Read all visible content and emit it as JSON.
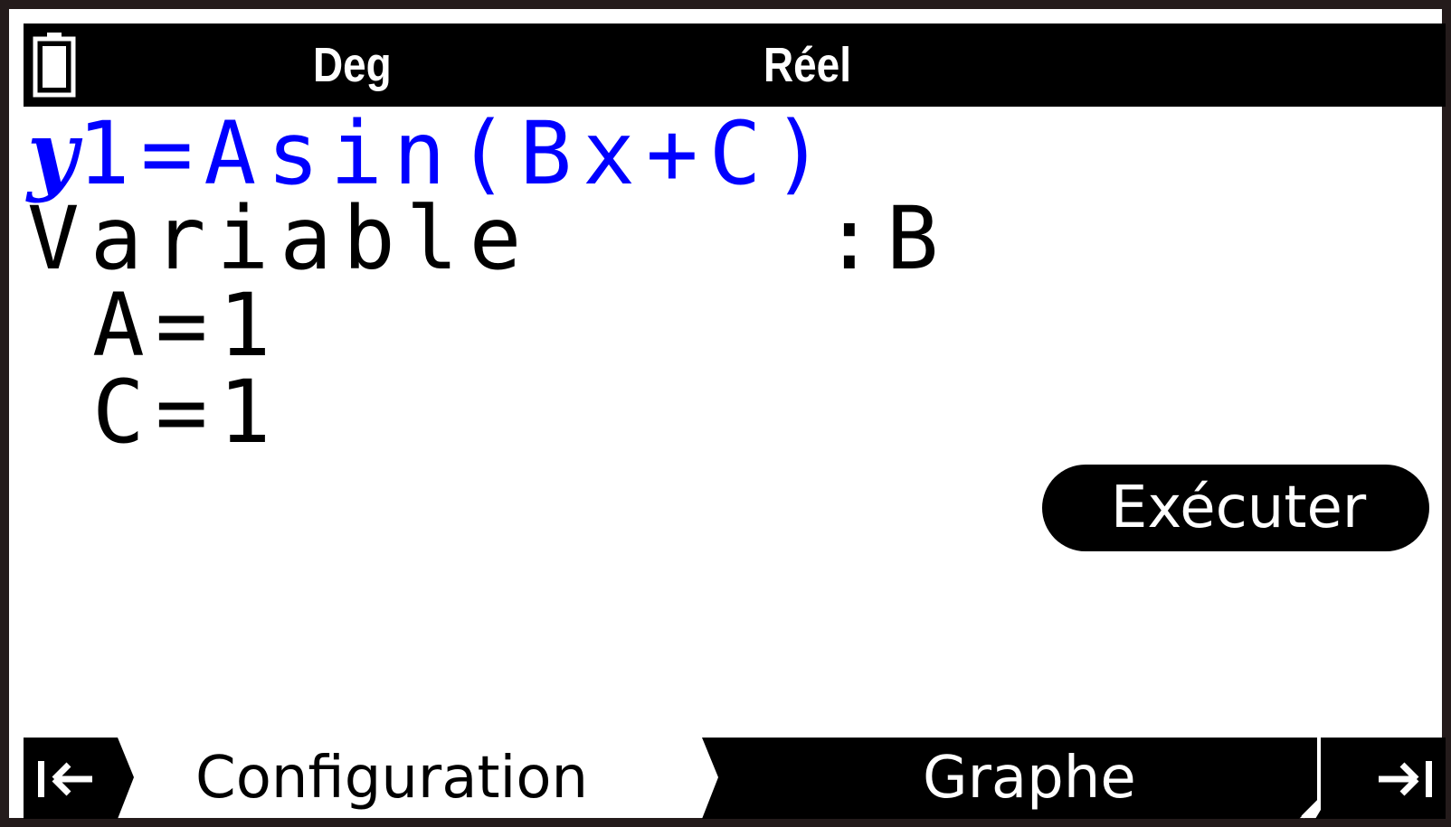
{
  "status_bar": {
    "angle_unit": "Deg",
    "number_mode": "Réel",
    "battery_icon": "battery-icon"
  },
  "editor": {
    "function_name": "y",
    "function_expr": "1=Asin(Bx+C)",
    "variable_label": "Variable",
    "variable_value": ":B",
    "params": [
      {
        "text": "A=1"
      },
      {
        "text": "C=1"
      }
    ]
  },
  "execute_button": {
    "label": "Exécuter"
  },
  "tabs": {
    "config_label": "Configuration",
    "graph_label": "Graphe",
    "left_icon": "jump-left-icon",
    "right_icon": "jump-right-icon"
  },
  "colors": {
    "accent": "#0000ff",
    "bar_bg": "#000000",
    "frame": "#241b1b"
  }
}
